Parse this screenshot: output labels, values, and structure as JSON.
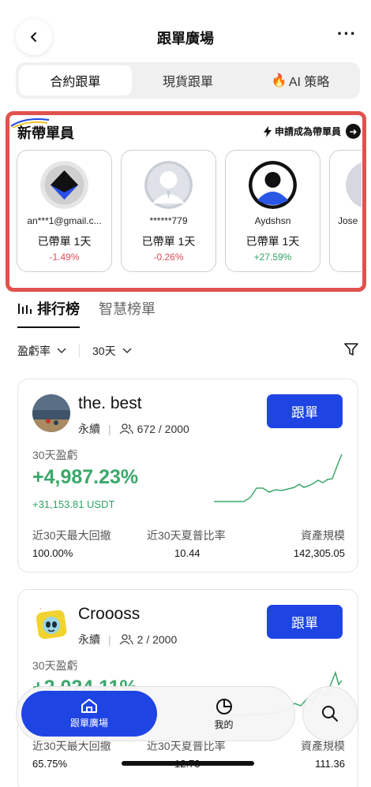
{
  "header": {
    "title": "跟單廣場"
  },
  "tabs": [
    "合約跟單",
    "現貨跟單",
    "AI 策略"
  ],
  "new_leaders": {
    "title": "新帶單員",
    "apply_label": "申請成為帶單員",
    "cards": [
      {
        "name": "an***1@gmail.c...",
        "days": "已帶單 1天",
        "pct": "-1.49%"
      },
      {
        "name": "******779",
        "days": "已帶單 1天",
        "pct": "-0.26%"
      },
      {
        "name": "Aydshsn",
        "days": "已帶單 1天",
        "pct": "+27.59%"
      },
      {
        "name": "Jose",
        "days": "",
        "pct": ""
      }
    ]
  },
  "ranking": {
    "tab_active": "排行榜",
    "tab_other": "智慧榜單",
    "filter_metric": "盈虧率",
    "filter_period": "30天"
  },
  "traders": [
    {
      "name": "the. best",
      "type": "永續",
      "followers": "672 / 2000",
      "follow_label": "跟單",
      "pnl_label": "30天盈虧",
      "pnl_pct": "+4,987.23%",
      "pnl_usdt": "+31,153.81 USDT",
      "stat_labels": [
        "近30天最大回撤",
        "近30天夏普比率",
        "資產規模"
      ],
      "stat_values": [
        "100.00%",
        "10.44",
        "142,305.05"
      ]
    },
    {
      "name": "Croooss",
      "type": "永續",
      "followers": "2 / 2000",
      "follow_label": "跟單",
      "pnl_label": "30天盈虧",
      "pnl_pct": "+2,024.11%",
      "pnl_usdt": "",
      "stat_labels": [
        "近30天最大回撤",
        "近30天夏普比率",
        "資產規模"
      ],
      "stat_values": [
        "65.75%",
        "12.73",
        "111.36"
      ]
    }
  ],
  "bottom_nav": {
    "home": "跟單廣場",
    "mine": "我的"
  },
  "colors": {
    "accent": "#1f44e4",
    "positive": "#2da463",
    "negative": "#e04b57",
    "highlight": "#e0524d"
  }
}
